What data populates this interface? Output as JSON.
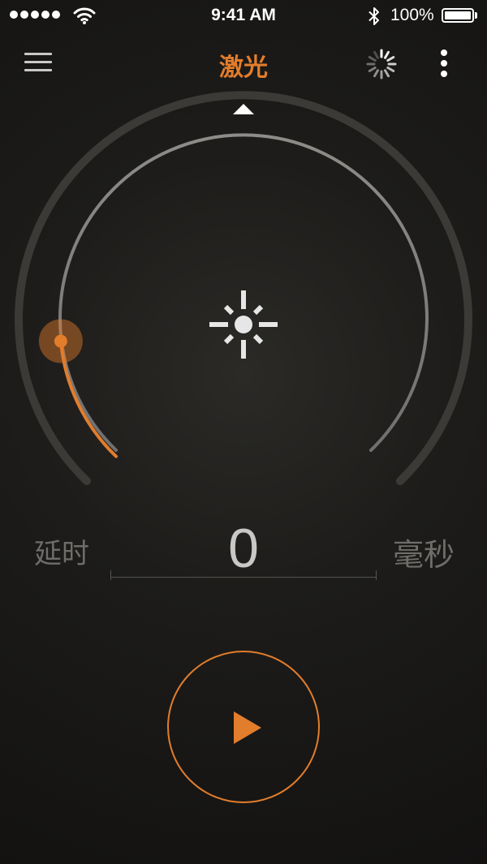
{
  "status_bar": {
    "time": "9:41 AM",
    "battery_percent": "100%",
    "signal_dots": 5,
    "icons": [
      "signal-dots",
      "wifi-icon",
      "bluetooth-icon",
      "battery-icon"
    ]
  },
  "nav": {
    "title": "激光",
    "left_icon": "hamburger-menu-icon",
    "right_icons": [
      "loading-spinner-icon",
      "more-vertical-icon"
    ]
  },
  "dial": {
    "center_icon": "sun-icon",
    "pointer_icon": "triangle-up-icon",
    "level_fraction": 0.04,
    "accent_color": "#e27d2c"
  },
  "delay": {
    "label": "延时",
    "value": "0",
    "unit": "毫秒"
  },
  "controls": {
    "play_icon": "play-icon",
    "accent_color": "#e27d2c"
  }
}
